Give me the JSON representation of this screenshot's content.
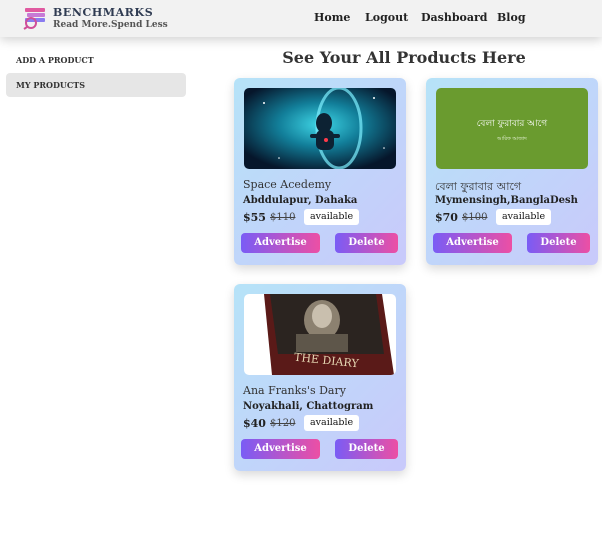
{
  "brand": {
    "name": "BENCHMARKS",
    "tagline": "Read More.Spend Less"
  },
  "nav": {
    "home": "Home",
    "logout": "Logout",
    "dashboard": "Dashboard",
    "blog": "Blog"
  },
  "sidebar": {
    "items": [
      {
        "label": "ADD A PRODUCT",
        "active": false
      },
      {
        "label": "MY PRODUCTS",
        "active": true
      }
    ]
  },
  "page": {
    "title": "See Your All Products Here"
  },
  "products": [
    {
      "title": "Space Acedemy",
      "location": "Abddulapur, Dahaka",
      "price": "$55",
      "original_price": "$110",
      "status": "available",
      "advertise_label": "Advertise",
      "delete_label": "Delete",
      "image_icon": "astronaut-image"
    },
    {
      "title": "বেলা ফুরাবার আগে",
      "location": "Mymensingh,BanglaDesh",
      "price": "$70",
      "original_price": "$100",
      "status": "available",
      "advertise_label": "Advertise",
      "delete_label": "Delete",
      "image_icon": "book-cover-image",
      "cover_title": "বেলা ফুরাবার আগে",
      "cover_author": "আরিফ আজাদ"
    },
    {
      "title": "Ana Franks's Dary",
      "location": "Noyakhali, Chattogram",
      "price": "$40",
      "original_price": "$120",
      "status": "available",
      "advertise_label": "Advertise",
      "delete_label": "Delete",
      "image_icon": "diary-book-image",
      "cover_title": "THE DIARY"
    }
  ],
  "colors": {
    "button_start": "#7a5cf5",
    "button_end": "#ec4fa4",
    "card_start": "#b6e3f8",
    "card_end": "#c9c9fb",
    "cover_green": "#6a9b2f"
  }
}
